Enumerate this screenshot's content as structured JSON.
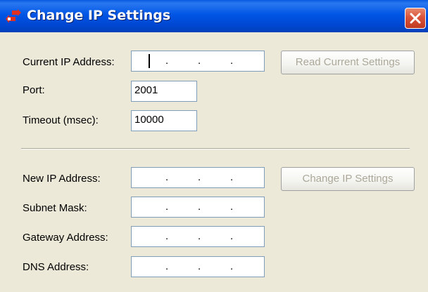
{
  "window": {
    "title": "Change IP Settings"
  },
  "current": {
    "ip_label": "Current IP Address:",
    "port_label": "Port:",
    "port_value": "2001",
    "timeout_label": "Timeout (msec):",
    "timeout_value": "10000",
    "read_button": "Read Current Settings"
  },
  "new": {
    "ip_label": "New IP Address:",
    "subnet_label": "Subnet Mask:",
    "gateway_label": "Gateway Address:",
    "dns_label": "DNS Address:",
    "change_button": "Change IP Settings"
  },
  "ip_separator": ".",
  "colors": {
    "titlebar": "#0055E5",
    "dialog_bg": "#ECE9D8",
    "close_button": "#D9543A",
    "disabled_text": "#ACA899"
  }
}
